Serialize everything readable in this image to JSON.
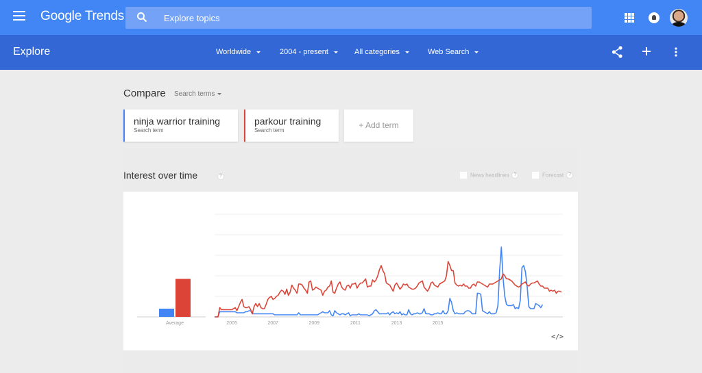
{
  "topbar": {
    "app_name_1": "Google",
    "app_name_2": "Trends",
    "search_placeholder": "Explore topics",
    "icons": [
      "menu-icon",
      "search-icon",
      "apps-icon",
      "notifications-icon",
      "avatar"
    ]
  },
  "subbar": {
    "title": "Explore",
    "filters": [
      {
        "label": "Worldwide"
      },
      {
        "label": "2004 - present"
      },
      {
        "label": "All categories"
      },
      {
        "label": "Web Search"
      }
    ],
    "actions": [
      "share-icon",
      "add-icon",
      "more-icon"
    ]
  },
  "compare": {
    "label": "Compare",
    "select": "Search terms",
    "terms": [
      {
        "name": "ninja warrior training",
        "sub": "Search term",
        "color": "#4285f4"
      },
      {
        "name": "parkour training",
        "sub": "Search term",
        "color": "#db4437"
      }
    ],
    "add_term": "+ Add term"
  },
  "interest": {
    "title": "Interest over time",
    "help": "?",
    "news_headlines": "News headlines",
    "forecast": "Forecast",
    "embed": "</>"
  },
  "chart_data": {
    "type": "line",
    "title": "Interest over time",
    "xlabel": "",
    "ylabel": "",
    "ylim": [
      0,
      100
    ],
    "grid": true,
    "x_start": "2004-01",
    "x_step": "month",
    "x_ticks": [
      "2005",
      "2007",
      "2009",
      "2011",
      "2013",
      "2015"
    ],
    "average_label": "Average",
    "average": {
      "ninja warrior training": 8,
      "parkour training": 37
    },
    "series": [
      {
        "name": "ninja warrior training",
        "color": "#4285f4",
        "values": [
          0,
          0,
          0,
          5,
          5,
          5,
          5,
          5,
          5,
          5,
          5,
          5,
          5,
          4,
          4,
          4,
          4,
          4,
          5,
          5,
          6,
          6,
          3,
          3,
          3,
          3,
          3,
          3,
          3,
          3,
          3,
          3,
          3,
          3,
          3,
          2,
          2,
          2,
          2,
          2,
          2,
          2,
          2,
          2,
          2,
          2,
          2,
          2,
          2,
          4,
          2,
          2,
          2,
          2,
          2,
          2,
          2,
          2,
          2,
          2,
          2,
          3,
          4,
          5,
          4,
          4,
          4,
          6,
          2,
          1,
          6,
          4,
          3,
          2,
          3,
          3,
          2,
          3,
          4,
          1,
          2,
          2,
          2,
          2,
          3,
          2,
          2,
          2,
          2,
          2,
          1,
          2,
          3,
          6,
          7,
          5,
          3,
          3,
          3,
          3,
          3,
          4,
          2,
          4,
          5,
          3,
          4,
          3,
          5,
          2,
          3,
          2,
          2,
          7,
          3,
          2,
          3,
          3,
          4,
          3,
          3,
          4,
          8,
          3,
          3,
          3,
          2,
          2,
          3,
          3,
          4,
          3,
          3,
          6,
          3,
          3,
          6,
          18,
          14,
          6,
          3,
          4,
          3,
          3,
          3,
          3,
          5,
          6,
          6,
          5,
          3,
          3,
          3,
          23,
          23,
          22,
          6,
          5,
          4,
          3,
          5,
          3,
          3,
          3,
          4,
          11,
          45,
          68,
          38,
          20,
          12,
          11,
          11,
          11,
          12,
          8,
          9,
          8,
          16,
          48,
          50,
          44,
          30,
          10,
          8,
          8,
          8,
          13,
          12,
          11,
          9,
          12
        ]
      },
      {
        "name": "parkour training",
        "color": "#db4437",
        "values": [
          0,
          0,
          0,
          9,
          7,
          7,
          7,
          7,
          7,
          7,
          7,
          8,
          9,
          6,
          10,
          14,
          17,
          10,
          9,
          9,
          10,
          7,
          3,
          10,
          13,
          10,
          13,
          9,
          8,
          8,
          12,
          17,
          19,
          20,
          17,
          18,
          20,
          21,
          24,
          26,
          25,
          22,
          27,
          21,
          24,
          31,
          28,
          26,
          23,
          32,
          32,
          31,
          28,
          26,
          23,
          34,
          35,
          26,
          27,
          29,
          28,
          27,
          26,
          21,
          25,
          26,
          29,
          30,
          35,
          24,
          23,
          28,
          32,
          34,
          29,
          27,
          26,
          30,
          31,
          28,
          32,
          32,
          33,
          28,
          31,
          33,
          33,
          35,
          37,
          29,
          30,
          30,
          36,
          34,
          36,
          40,
          46,
          50,
          45,
          42,
          33,
          32,
          31,
          28,
          25,
          31,
          33,
          30,
          27,
          29,
          32,
          31,
          32,
          29,
          28,
          27,
          27,
          28,
          30,
          33,
          34,
          35,
          29,
          27,
          25,
          28,
          33,
          34,
          31,
          30,
          29,
          32,
          33,
          34,
          35,
          40,
          54,
          50,
          45,
          45,
          33,
          31,
          30,
          31,
          30,
          32,
          30,
          30,
          28,
          28,
          31,
          32,
          30,
          34,
          34,
          33,
          32,
          31,
          30,
          29,
          32,
          32,
          32,
          33,
          34,
          35,
          36,
          37,
          42,
          40,
          37,
          37,
          36,
          35,
          33,
          31,
          30,
          29,
          30,
          32,
          33,
          34,
          31,
          30,
          32,
          33,
          33,
          34,
          35,
          32,
          30,
          30,
          28,
          28,
          28,
          25,
          26,
          25,
          26,
          23,
          25,
          25,
          24
        ]
      }
    ]
  }
}
